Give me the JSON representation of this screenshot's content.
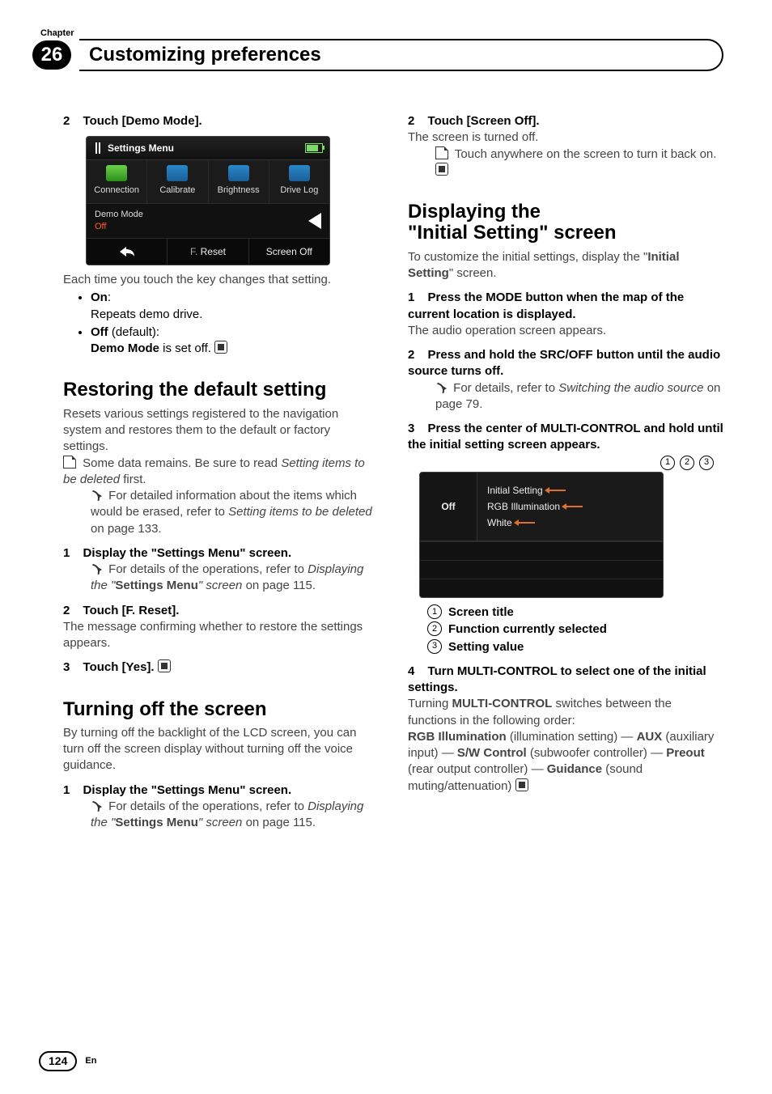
{
  "chapter": {
    "label": "Chapter",
    "number": "26",
    "title": "Customizing preferences"
  },
  "page": {
    "number": "124",
    "lang": "En"
  },
  "col1": {
    "demo_step": {
      "num": "2",
      "title": "Touch [Demo Mode]."
    },
    "shot1": {
      "title": "Settings Menu",
      "cells": [
        "Connection",
        "Calibrate",
        "Brightness",
        "Drive Log"
      ],
      "demo_label": "Demo Mode",
      "demo_value": "Off",
      "footer_reset_pre": "F. ",
      "footer_reset": "Reset",
      "footer_screenoff": "Screen Off"
    },
    "after_shot": "Each time you touch the key changes that setting.",
    "bul_on": "On",
    "bul_on_colon": ":",
    "bul_on_sub": "Repeats demo drive.",
    "bul_off": "Off",
    "bul_off_paren": " (default):",
    "bul_off_sub_pre": "Demo Mode",
    "bul_off_sub_post": " is set off.",
    "h2_restore": "Restoring the default setting",
    "restore_p": "Resets various settings registered to the navigation system and restores them to the default or factory settings.",
    "restore_note_pre": "Some data remains. Be sure to read ",
    "restore_note_it": "Setting items to be deleted",
    "restore_note_post": " first.",
    "restore_ref_pre": "For detailed information about the items which would be erased, refer to ",
    "restore_ref_it": "Setting items to be deleted",
    "restore_ref_post": " on page 133.",
    "rs1": {
      "num": "1",
      "title": "Display the \"Settings Menu\" screen."
    },
    "rs1_ref_pre": "For details of the operations, refer to ",
    "rs1_ref_it1": "Displaying the \"",
    "rs1_ref_bold": "Settings Menu",
    "rs1_ref_it2": "\" screen",
    "rs1_ref_post": " on page 115.",
    "rs2": {
      "num": "2",
      "title": "Touch [F. Reset]."
    },
    "rs2_body": "The message confirming whether to restore the settings appears.",
    "rs3": {
      "num": "3",
      "title": "Touch [Yes]."
    },
    "h2_off": "Turning off the screen",
    "off_p": "By turning off the backlight of the LCD screen, you can turn off the screen display without turning off the voice guidance.",
    "off1": {
      "num": "1",
      "title": "Display the \"Settings Menu\" screen."
    }
  },
  "col2": {
    "so2": {
      "num": "2",
      "title": "Touch [Screen Off]."
    },
    "so2_body": "The screen is turned off.",
    "so2_note": "Touch anywhere on the screen to turn it back on.",
    "h2_init_a": "Displaying the",
    "h2_init_b": "\"Initial Setting\" screen",
    "init_p_pre": "To customize the initial settings, display the \"",
    "init_p_bold": "Initial Setting",
    "init_p_post": "\" screen.",
    "is1": {
      "num": "1",
      "title": "Press the MODE button when the map of the current location is displayed."
    },
    "is1_body": "The audio operation screen appears.",
    "is2": {
      "num": "2",
      "title": "Press and hold the SRC/OFF button until the audio source turns off."
    },
    "is2_ref_pre": "For details, refer to ",
    "is2_ref_it": "Switching the audio source",
    "is2_ref_post": " on page 79.",
    "is3": {
      "num": "3",
      "title": "Press the center of MULTI-CONTROL and hold until the initial setting screen appears."
    },
    "shot2": {
      "off": "Off",
      "line1": "Initial Setting",
      "line2": "RGB Illumination",
      "line3": "White",
      "call1": "1",
      "call2": "2",
      "call3": "3"
    },
    "legend": {
      "n1": "1",
      "l1": "Screen title",
      "n2": "2",
      "l2": "Function currently selected",
      "n3": "3",
      "l3": "Setting value"
    },
    "is4": {
      "num": "4",
      "title": "Turn MULTI-CONTROL to select one of the initial settings."
    },
    "is4_body_pre": "Turning ",
    "is4_body_bold": "MULTI-CONTROL",
    "is4_body_mid": " switches between the functions in the following order:",
    "opt1": "RGB Illumination",
    "opt1_d": " (illumination setting) — ",
    "opt2": "AUX",
    "opt2_d": " (auxiliary input) — ",
    "opt3": "S/W Control",
    "opt3_d": " (subwoofer controller) — ",
    "opt4": "Preout",
    "opt4_d": " (rear output controller) — ",
    "opt5": "Guidance",
    "opt5_d": " (sound muting/attenuation)"
  }
}
